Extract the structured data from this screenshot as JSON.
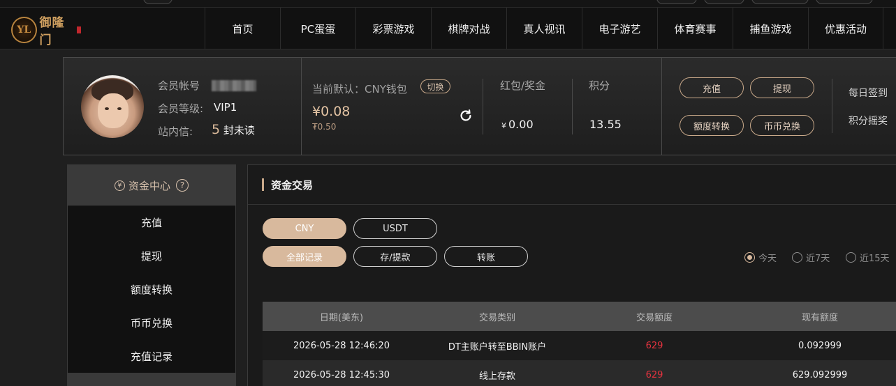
{
  "brand": {
    "logo_text": "御隆门"
  },
  "nav": {
    "items": [
      "首页",
      "PC蛋蛋",
      "彩票游戏",
      "棋牌对战",
      "真人视讯",
      "电子游艺",
      "体育赛事",
      "捕鱼游戏",
      "优惠活动"
    ]
  },
  "profile": {
    "account_label": "会员帐号",
    "level_label": "会员等级:",
    "level_value": "VIP1",
    "inbox_label": "站内信:",
    "inbox_count": "5",
    "inbox_suffix": "封未读"
  },
  "wallet": {
    "default_label": "当前默认：CNY钱包",
    "switch_label": "切换",
    "balance_main": "¥0.08",
    "balance_sub": "₮0.50",
    "bonus_label": "红包/奖金",
    "bonus_currency": "¥",
    "bonus_value": "0.00",
    "points_label": "积分",
    "points_value": "13.55"
  },
  "actions": {
    "deposit": "充值",
    "withdraw": "提现",
    "transfer": "额度转换",
    "exchange": "币币兑换",
    "daily_signin": "每日签到",
    "points_lottery": "积分摇奖"
  },
  "sidebar": {
    "title": "资金中心",
    "title_icon": "¥",
    "help_icon": "?",
    "items": [
      "充值",
      "提现",
      "额度转换",
      "币币兑换",
      "充值记录"
    ]
  },
  "main": {
    "title": "资金交易",
    "currency_tabs": [
      "CNY",
      "USDT"
    ],
    "type_tabs": [
      "全部记录",
      "存/提款",
      "转账"
    ],
    "periods": [
      "今天",
      "近7天",
      "近15天"
    ],
    "table": {
      "headers": [
        "日期(美东)",
        "交易类别",
        "交易额度",
        "现有额度"
      ],
      "rows": [
        {
          "date": "2026-05-28 12:46:20",
          "type": "DT主账户转至BBIN账户",
          "amount": "629",
          "balance": "0.092999"
        },
        {
          "date": "2026-05-28 12:45:30",
          "type": "线上存款",
          "amount": "629",
          "balance": "629.092999"
        }
      ]
    }
  },
  "colors": {
    "accent": "#d8b99d",
    "amount_red": "#e5333f",
    "panel": "#1a1a1a"
  }
}
